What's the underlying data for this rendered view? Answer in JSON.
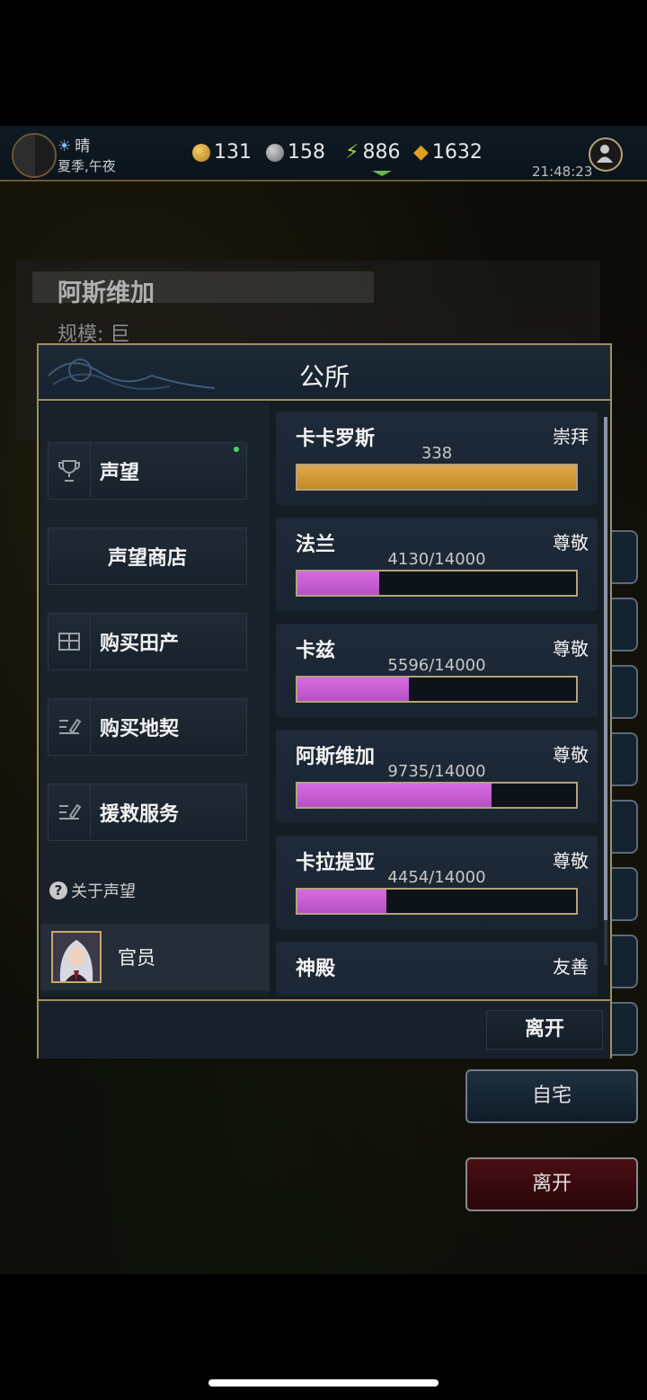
{
  "hud": {
    "weather": "晴",
    "season_time": "夏季,午夜",
    "gold": "131",
    "silver": "158",
    "energy": "886",
    "gems": "1632",
    "clock": "21:48:23"
  },
  "city": {
    "name": "阿斯维加",
    "scale": "规模: 巨"
  },
  "background_buttons": {
    "home": "自宅",
    "leave": "离开"
  },
  "modal": {
    "title": "公所",
    "menu": [
      {
        "label": "声望",
        "icon": "trophy-icon",
        "has_notification": true
      },
      {
        "label": "声望商店"
      },
      {
        "label": "购买田产",
        "icon": "field-icon"
      },
      {
        "label": "购买地契",
        "icon": "deed-icon"
      },
      {
        "label": "援救服务",
        "icon": "rescue-icon"
      }
    ],
    "about_label": "关于声望",
    "official_label": "官员",
    "factions": [
      {
        "name": "卡卡罗斯",
        "rank": "崇拜",
        "value_text": "338",
        "progress": 1.0,
        "color": "gold"
      },
      {
        "name": "法兰",
        "rank": "尊敬",
        "value_text": "4130/14000",
        "progress": 0.295,
        "color": "pink"
      },
      {
        "name": "卡兹",
        "rank": "尊敬",
        "value_text": "5596/14000",
        "progress": 0.3997,
        "color": "pink"
      },
      {
        "name": "阿斯维加",
        "rank": "尊敬",
        "value_text": "9735/14000",
        "progress": 0.6954,
        "color": "pink"
      },
      {
        "name": "卡拉提亚",
        "rank": "尊敬",
        "value_text": "4454/14000",
        "progress": 0.3181,
        "color": "pink"
      },
      {
        "name": "神殿",
        "rank": "友善",
        "value_text": "",
        "progress": 0,
        "color": "pink"
      }
    ],
    "leave_label": "离开"
  }
}
